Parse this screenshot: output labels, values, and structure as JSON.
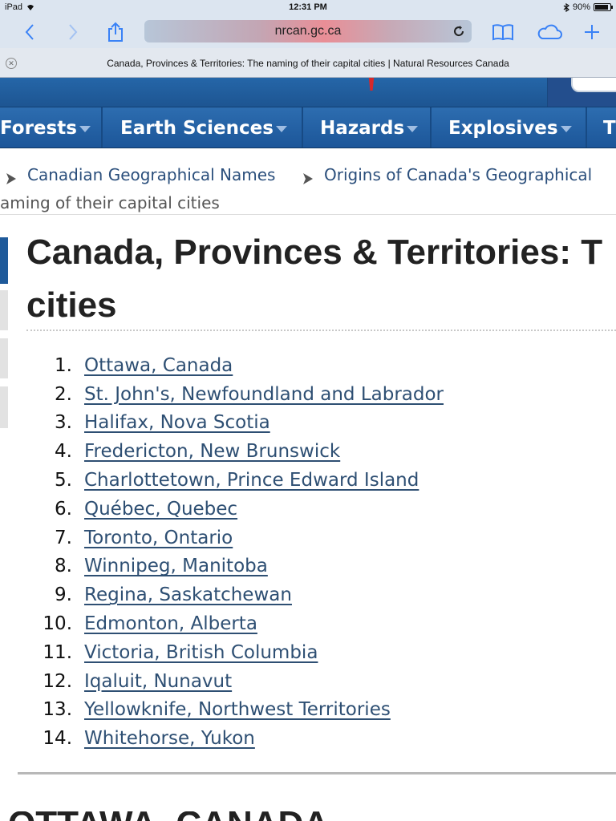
{
  "status_bar": {
    "device": "iPad",
    "time": "12:31 PM",
    "battery": "90%",
    "battery_level": 0.9
  },
  "toolbar": {
    "url": "nrcan.gc.ca",
    "accent_color": "#3a82f6"
  },
  "tab": {
    "title": "Canada, Provinces & Territories: The naming of their capital cities | Natural Resources Canada"
  },
  "nav": {
    "items": [
      {
        "label": "Forests"
      },
      {
        "label": "Earth Sciences"
      },
      {
        "label": "Hazards"
      },
      {
        "label": "Explosives"
      },
      {
        "label": "T"
      }
    ],
    "color": "#1c5699"
  },
  "breadcrumb": {
    "items": [
      "Canadian Geographical Names",
      "Origins of Canada's Geographical"
    ],
    "current": "aming of their capital cities"
  },
  "page": {
    "title_line1": "Canada, Provinces & Territories: T",
    "title_line2": "cities",
    "capitals": [
      {
        "num": "1.",
        "label": "Ottawa, Canada"
      },
      {
        "num": "2.",
        "label": "St. John's, Newfoundland and Labrador"
      },
      {
        "num": "3.",
        "label": "Halifax, Nova Scotia"
      },
      {
        "num": "4.",
        "label": "Fredericton, New Brunswick"
      },
      {
        "num": "5.",
        "label": "Charlottetown, Prince Edward Island"
      },
      {
        "num": "6.",
        "label": "Québec, Quebec"
      },
      {
        "num": "7.",
        "label": "Toronto, Ontario"
      },
      {
        "num": "8.",
        "label": "Winnipeg, Manitoba"
      },
      {
        "num": "9.",
        "label": "Regina, Saskatchewan"
      },
      {
        "num": "10.",
        "label": "Edmonton, Alberta"
      },
      {
        "num": "11.",
        "label": "Victoria, British Columbia"
      },
      {
        "num": "12.",
        "label": "Iqaluit, Nunavut"
      },
      {
        "num": "13.",
        "label": "Yellowknife, Northwest Territories"
      },
      {
        "num": "14.",
        "label": "Whitehorse, Yukon"
      }
    ],
    "next_heading": "OTTAWA, CANADA",
    "link_color": "#2e4f73"
  }
}
